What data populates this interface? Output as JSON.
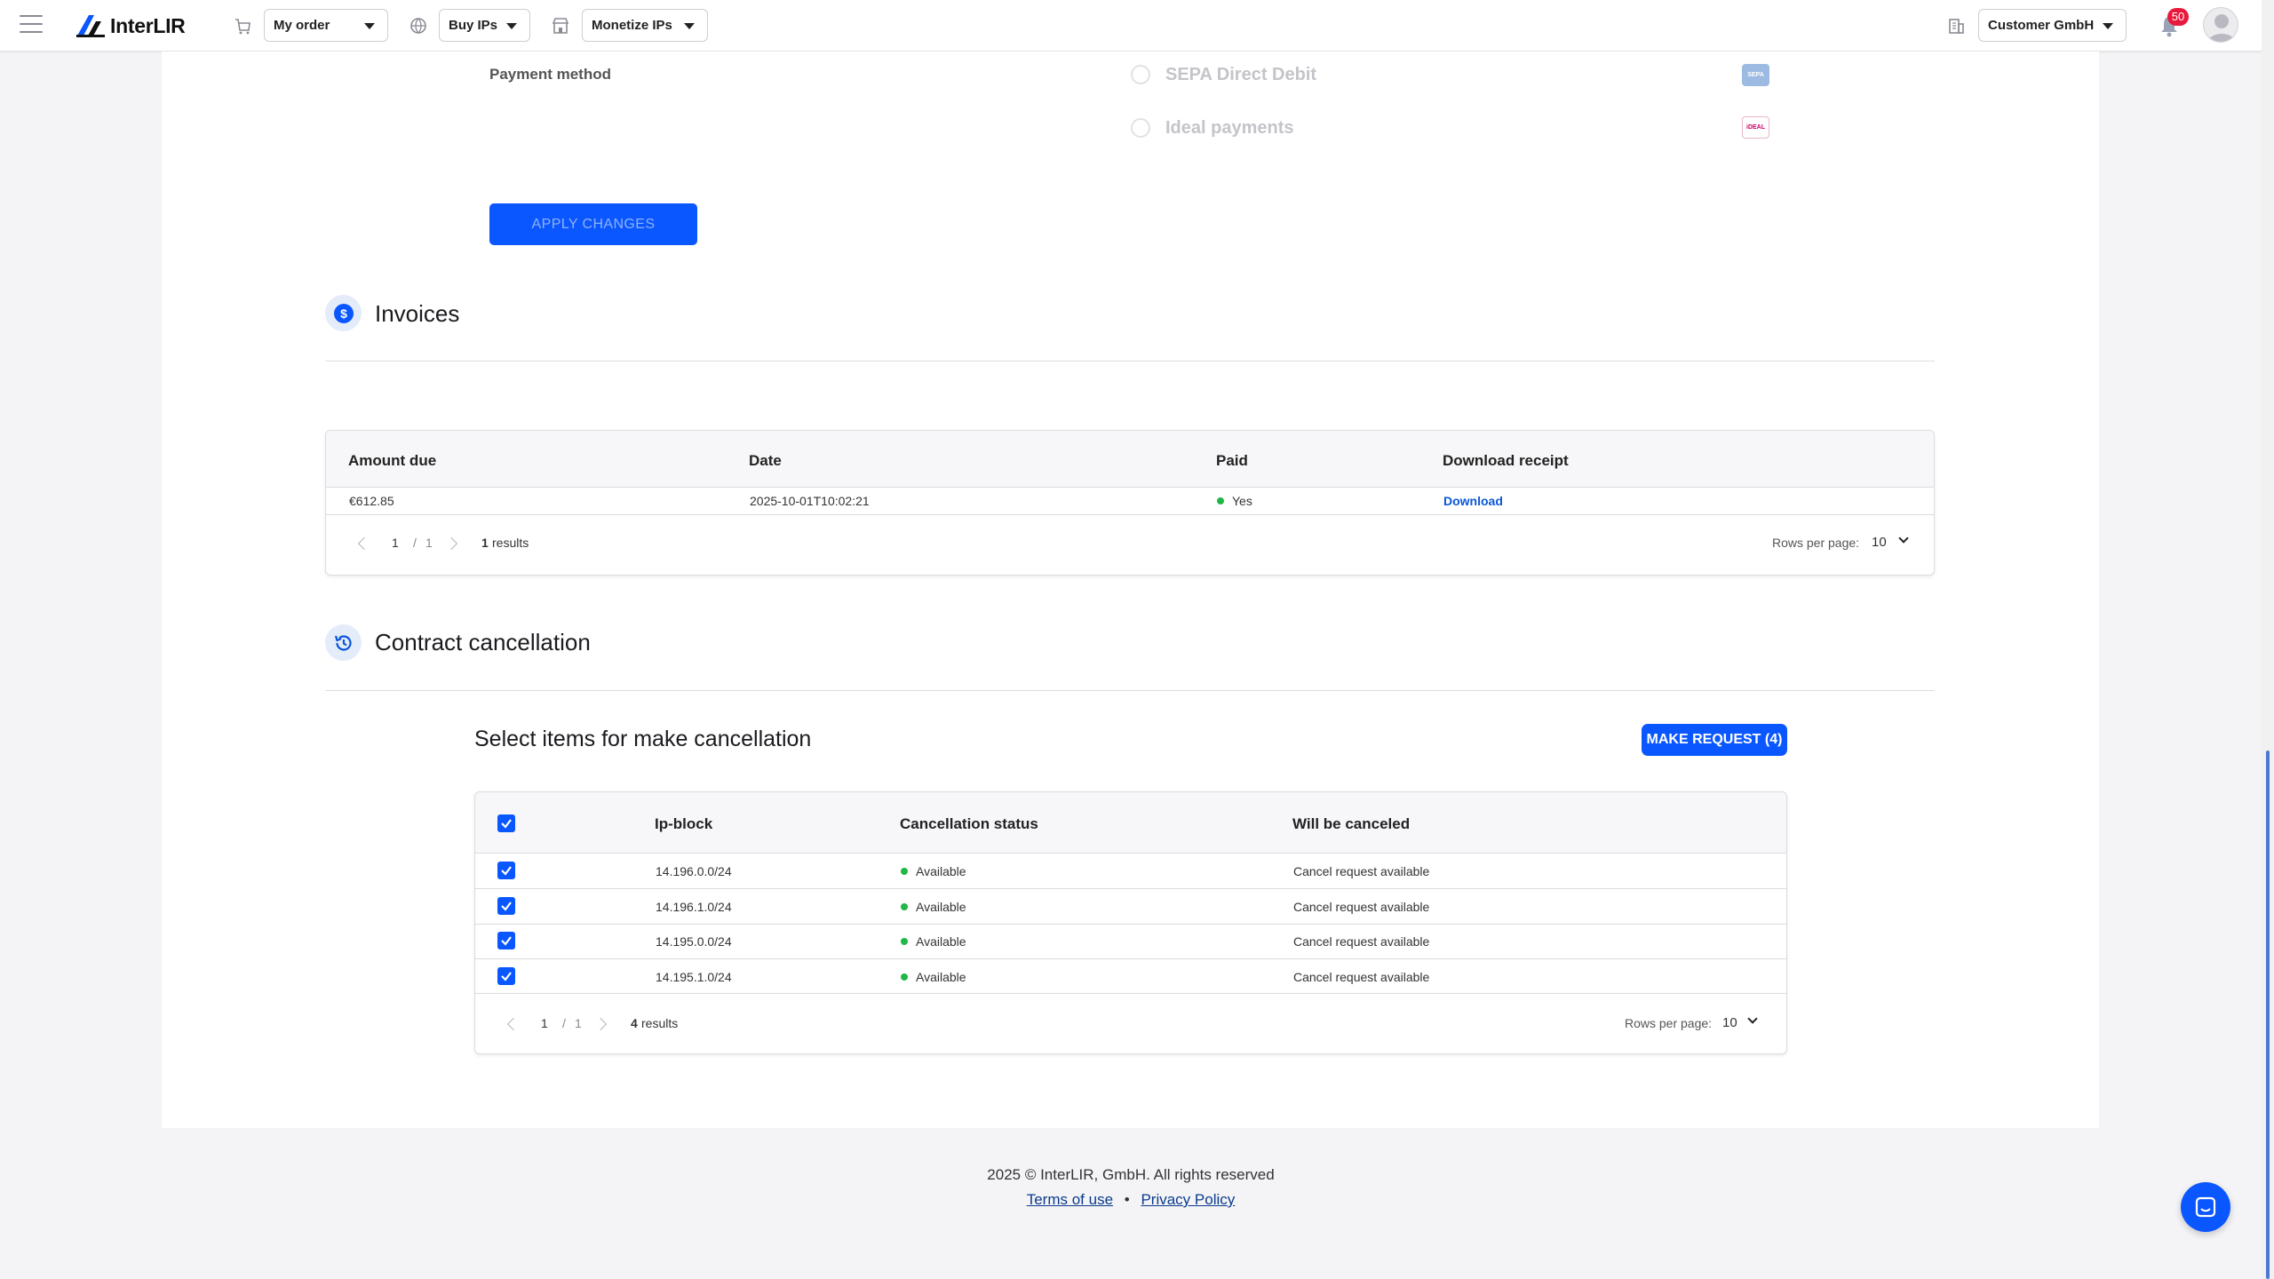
{
  "header": {
    "brand": "InterLIR",
    "my_order": "My order",
    "buy_ips": "Buy IPs",
    "monetize_ips": "Monetize IPs",
    "company": "Customer GmbH",
    "notification_count": "50"
  },
  "payment": {
    "label": "Payment method",
    "options": [
      "SEPA Direct Debit",
      "Ideal payments"
    ],
    "apply_label": "APPLY CHANGES"
  },
  "invoices": {
    "title": "Invoices",
    "columns": [
      "Amount due",
      "Date",
      "Paid",
      "Download receipt"
    ],
    "rows": [
      {
        "amount": "€612.85",
        "date": "2025-10-01T10:02:21",
        "paid": "Yes",
        "download": "Download"
      }
    ],
    "page": "1",
    "page_sep": "/",
    "total_pages": "1",
    "results_count": "1",
    "results_word": "results",
    "rows_per_page_label": "Rows per page:",
    "rows_per_page": "10"
  },
  "cancellation": {
    "title": "Contract cancellation",
    "select_title": "Select items for make cancellation",
    "make_request_label": "MAKE REQUEST (4)",
    "columns": [
      "Ip-block",
      "Cancellation status",
      "Will be canceled"
    ],
    "rows": [
      {
        "ip": "14.196.0.0/24",
        "status": "Available",
        "will": "Cancel request available"
      },
      {
        "ip": "14.196.1.0/24",
        "status": "Available",
        "will": "Cancel request available"
      },
      {
        "ip": "14.195.0.0/24",
        "status": "Available",
        "will": "Cancel request available"
      },
      {
        "ip": "14.195.1.0/24",
        "status": "Available",
        "will": "Cancel request available"
      }
    ],
    "page": "1",
    "page_sep": "/",
    "total_pages": "1",
    "results_count": "4",
    "results_word": "results",
    "rows_per_page_label": "Rows per page:",
    "rows_per_page": "10"
  },
  "footer": {
    "copyright": "2025 © InterLIR, GmbH. All rights reserved",
    "terms": "Terms of use",
    "separator": "•",
    "privacy": "Privacy Policy"
  },
  "colors": {
    "accent": "#0a57ff",
    "status_green": "#1fb847",
    "badge_red": "#e8193c"
  }
}
